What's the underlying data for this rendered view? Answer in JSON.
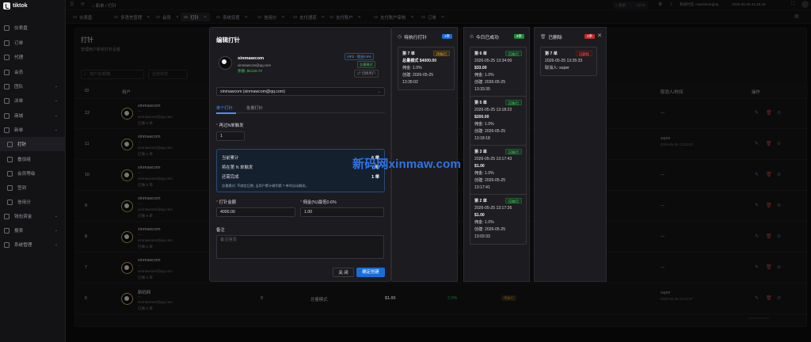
{
  "app": {
    "title": "tiktok"
  },
  "sidebar": {
    "items": [
      {
        "label": "仪表盘",
        "sub": false,
        "chev": false
      },
      {
        "label": "订单",
        "sub": false,
        "chev": false
      },
      {
        "label": "代理",
        "sub": false,
        "chev": false
      },
      {
        "label": "会员",
        "sub": false,
        "chev": false
      },
      {
        "label": "团队",
        "sub": false,
        "chev": true
      },
      {
        "label": "派单",
        "sub": false,
        "chev": true
      },
      {
        "label": "商城",
        "sub": false,
        "chev": true
      },
      {
        "label": "新单",
        "sub": false,
        "chev": true
      },
      {
        "label": "打针",
        "sub": true,
        "chev": false,
        "active": true
      },
      {
        "label": "叠加组",
        "sub": true,
        "chev": false
      },
      {
        "label": "会员等级",
        "sub": true,
        "chev": false
      },
      {
        "label": "签到",
        "sub": true,
        "chev": false
      },
      {
        "label": "信用分",
        "sub": true,
        "chev": false
      },
      {
        "label": "钱包资金",
        "sub": false,
        "chev": true
      },
      {
        "label": "报表",
        "sub": false,
        "chev": true
      },
      {
        "label": "系统管理",
        "sub": false,
        "chev": true
      }
    ]
  },
  "topbar": {
    "breadcrumb_home": "新单",
    "breadcrumb_current": "打针",
    "search_placeholder": "搜索",
    "search_shortcut": "Ctrl K",
    "timezone": "系统时区 Asia/Shanghai",
    "datetime": "2026-05-25 21:35:49"
  },
  "tabs": [
    {
      "label": "仪表盘",
      "closable": false
    },
    {
      "label": "多语言管理",
      "closable": true
    },
    {
      "label": "会员",
      "closable": true
    },
    {
      "label": "打针",
      "closable": true,
      "active": true
    },
    {
      "label": "系统设置",
      "closable": true
    },
    {
      "label": "信用分",
      "closable": true
    },
    {
      "label": "支付通道",
      "closable": true
    },
    {
      "label": "支付账户",
      "closable": true
    },
    {
      "label": "支付账户审核",
      "closable": true
    },
    {
      "label": "订单",
      "closable": true
    }
  ],
  "page": {
    "title": "打针",
    "subtitle": "管理用户新单打针设置",
    "search_placeholder": "用户名/邮箱",
    "status_placeholder": "全部状态"
  },
  "table": {
    "headers": [
      "ID",
      "用户",
      "取消人/时间",
      "操作"
    ],
    "rows": [
      {
        "id": "12",
        "name": "xinmawcom",
        "line2": "—",
        "email": "xinmawcom@qq.com",
        "orders": "已做 6 单",
        "cancel": "—",
        "cancel_time": ""
      },
      {
        "id": "11",
        "name": "xinmawcom",
        "line2": "—",
        "email": "xinmawcom@qq.com",
        "orders": "已做 6 单",
        "cancel": "super",
        "cancel_time": "2026-05-25 13:25:03"
      },
      {
        "id": "10",
        "name": "xinmawcom",
        "line2": "—",
        "email": "xinmawcom@qq.com",
        "orders": "已做 6 单",
        "cancel": "—",
        "cancel_time": ""
      },
      {
        "id": "9",
        "name": "xinmawcom",
        "line2": "—",
        "email": "xinmawcom@qq.com",
        "orders": "已做 6 单",
        "cancel": "—",
        "cancel_time": ""
      },
      {
        "id": "8",
        "name": "xinmawcom",
        "line2": "—",
        "email": "xinmawcom@qq.com",
        "orders": "已做 6 单",
        "cancel": "—",
        "cancel_time": ""
      },
      {
        "id": "7",
        "name": "xinmawcom",
        "line2": "—",
        "email": "xinmawcom@qq.com",
        "orders": "已做 6 单",
        "cancel": "—",
        "cancel_time": ""
      },
      {
        "id": "6",
        "name": "新码网",
        "line2": "—",
        "email": "xinmawcom@qq.com",
        "orders": "已做 6 单",
        "cancel": "super",
        "cancel_time": "2026-05-25 13:44:37",
        "nth": "9",
        "mode": "总量模式",
        "amount": "$1.00",
        "rate": "2.0%",
        "status": "待执行"
      }
    ]
  },
  "modal": {
    "title": "编辑打针",
    "user": {
      "name": "xinmawcom",
      "email": "xinmawcom@qq.com",
      "balance": "余额: $2126.70",
      "vip": "VIP2 · 佣金0.6%",
      "mode": "总量模式",
      "switch_btn": "切换用户"
    },
    "select_value": "xinmawcom (xinmawcom@qq.com)",
    "tabs": [
      "单个打针",
      "批量打针"
    ],
    "nth_label": "再过N单触发",
    "nth_value": "1",
    "info": {
      "l1": "当前累计",
      "l2": "将在第 N 单触发",
      "l3": "还需完成",
      "v1": "6 单",
      "v2": "7 单",
      "v3": "1 单",
      "note": "总量模式: 不绑定日期, 当用户累计做到第 7 单时自动触发。"
    },
    "amount_label": "打针金额",
    "amount_value": "4000.00",
    "rate_label": "佣金(%)最低0.6%",
    "rate_value": "1.00",
    "remark_label": "备注",
    "remark_placeholder": "备注信息",
    "cancel_btn": "关 闭",
    "confirm_btn": "确定创建"
  },
  "watermark": "新码网xinmaw.com",
  "board": {
    "pending": {
      "title": "待执行打针",
      "count": "1条",
      "cards": [
        {
          "t": "第 7 单",
          "tag": "待执行",
          "bold": "总量模式 $4000.00",
          "l2": "佣金: 1.0%",
          "l3": "创建: 2026-05-25 13:35:02"
        }
      ]
    },
    "done": {
      "title": "今日已成功",
      "count": "4条",
      "cards": [
        {
          "t": "第 6 单",
          "tag": "已执行",
          "l1": "2026-05-25 13:34:00",
          "bold": "$33.00",
          "l2": "佣金: 1.0%",
          "l3": "创建: 2026-05-25 13:33:35"
        },
        {
          "t": "第 5 单",
          "tag": "已执行",
          "l1": "2026-05-25 13:18:22",
          "bold": "$200.00",
          "l2": "佣金: 1.0%",
          "l3": "创建: 2026-05-25 13:18:18"
        },
        {
          "t": "第 3 单",
          "tag": "已执行",
          "l1": "2026-05-25 13:17:43",
          "bold": "$1.00",
          "l2": "佣金: 1.0%",
          "l3": "创建: 2026-05-25 13:17:41"
        },
        {
          "t": "第 2 单",
          "tag": "已执行",
          "l1": "2026-05-25 13:17:26",
          "bold": "$1.00",
          "l2": "佣金: 1.0%",
          "l3": "创建: 2026-05-25 13:03:33"
        }
      ]
    },
    "cancelled": {
      "title": "已删除",
      "count": "1条",
      "cards": [
        {
          "t": "第 7 单",
          "tag": "已删除",
          "l1": "2026-05-25 13:35:33",
          "l2": "取消人: super"
        }
      ]
    }
  }
}
